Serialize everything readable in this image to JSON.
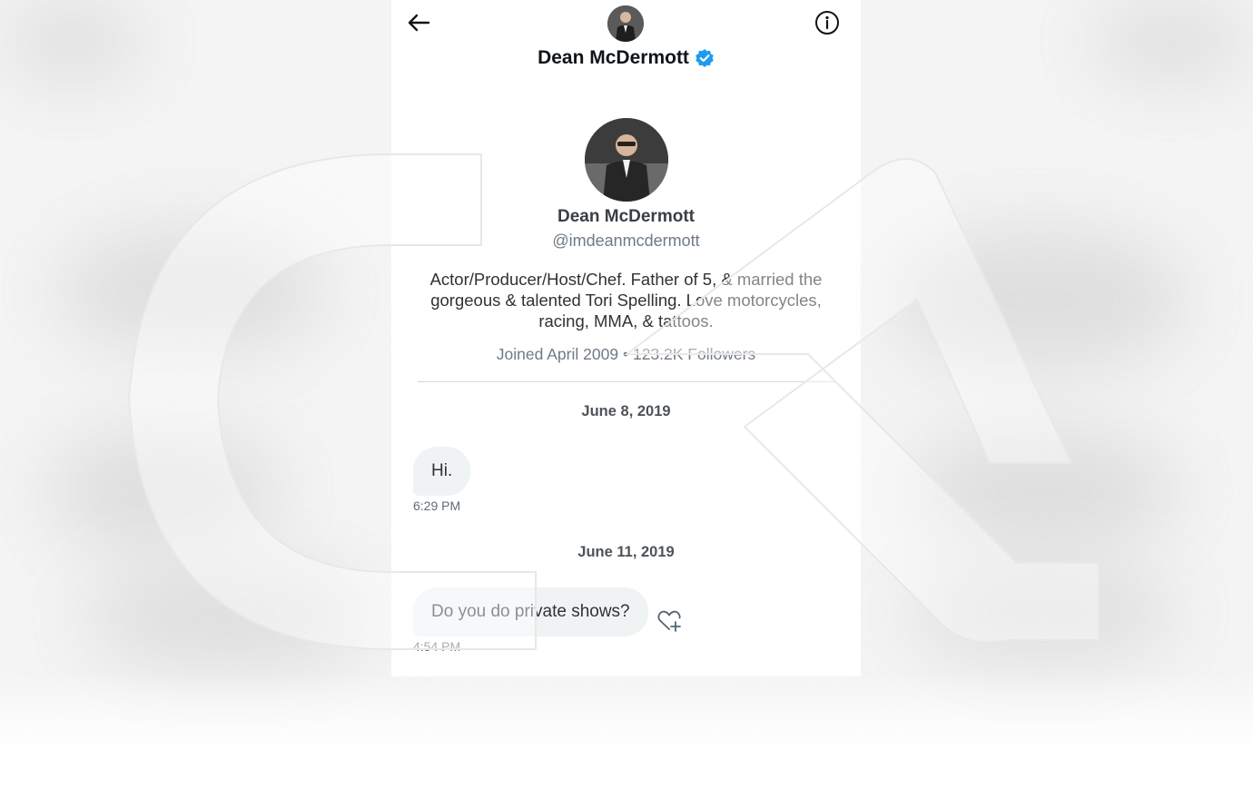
{
  "header": {
    "name": "Dean McDermott"
  },
  "profile": {
    "name": "Dean McDermott",
    "handle": "@imdeanmcdermott",
    "bio": "Actor/Producer/Host/Chef. Father of 5, & married the gorgeous & talented Tori Spelling. Love motorcycles, racing, MMA, & tattoos.",
    "joined": "Joined April 2009",
    "followers": "123.2K Followers",
    "separator": "•"
  },
  "conversation": [
    {
      "date": "June 8, 2019",
      "message": "Hi.",
      "time": "6:29 PM"
    },
    {
      "date": "June 11, 2019",
      "message": "Do you do private shows?",
      "time": "4:54 PM"
    }
  ],
  "colors": {
    "verified": "#1d9bf0",
    "bubble": "#eff3f4",
    "divider": "#cfd9de"
  },
  "icons": {
    "back": "arrow-left-icon",
    "info": "info-circle-icon",
    "verified": "verified-badge-icon",
    "like": "heart-plus-icon"
  }
}
